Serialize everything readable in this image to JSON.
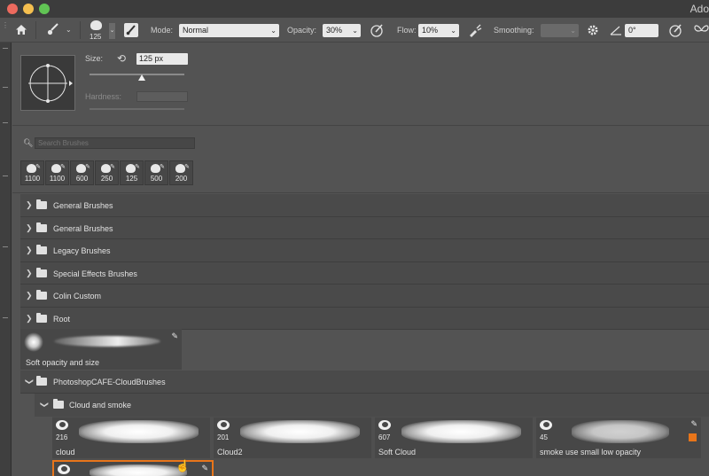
{
  "window": {
    "app_title": "Ado"
  },
  "options": {
    "brush_size": "125",
    "mode_label": "Mode:",
    "mode_value": "Normal",
    "opacity_label": "Opacity:",
    "opacity_value": "30%",
    "flow_label": "Flow:",
    "flow_value": "10%",
    "smoothing_label": "Smoothing:",
    "smoothing_value": "",
    "angle_value": "0°"
  },
  "brush_settings": {
    "size_label": "Size:",
    "size_value": "125 px",
    "size_slider_fraction": 0.55,
    "hardness_label": "Hardness:",
    "hardness_value": ""
  },
  "search": {
    "placeholder": "Search Brushes"
  },
  "recent_brushes": [
    "1100",
    "1100",
    "600",
    "250",
    "125",
    "500",
    "200"
  ],
  "groups": [
    {
      "name": "General Brushes"
    },
    {
      "name": "General Brushes"
    },
    {
      "name": "Legacy Brushes"
    },
    {
      "name": "Special Effects Brushes"
    },
    {
      "name": "Colin Custom"
    },
    {
      "name": "Root"
    }
  ],
  "root_brush": {
    "name": "Soft opacity and size"
  },
  "cloud_group": {
    "name": "PhotoshopCAFE-CloudBrushes",
    "subgroup": "Cloud and smoke",
    "brushes": [
      {
        "count": "216",
        "name": "cloud"
      },
      {
        "count": "201",
        "name": "Cloud2"
      },
      {
        "count": "607",
        "name": "Soft Cloud"
      },
      {
        "count": "45",
        "name": "smoke use small low opacity"
      }
    ]
  },
  "colors": {
    "accent": "#e8751a",
    "panel": "#535353",
    "row": "#4a4a4a"
  }
}
